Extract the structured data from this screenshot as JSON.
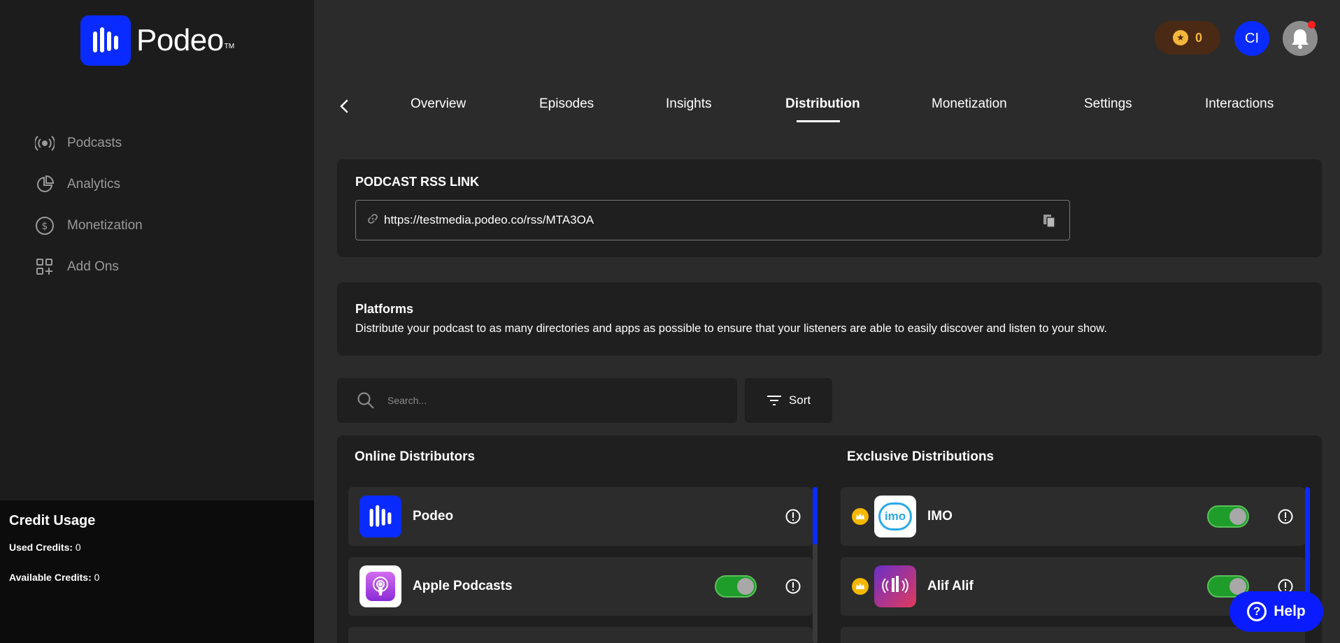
{
  "brand": {
    "name": "Podeo",
    "tm": "TM"
  },
  "sidebar": {
    "items": [
      {
        "label": "Podcasts",
        "icon": "podcast-icon"
      },
      {
        "label": "Analytics",
        "icon": "pie-chart-icon"
      },
      {
        "label": "Monetization",
        "icon": "dollar-icon"
      },
      {
        "label": "Add Ons",
        "icon": "add-ons-icon"
      }
    ],
    "credits": {
      "title": "Credit Usage",
      "used_label": "Used Credits:",
      "used_value": "0",
      "available_label": "Available Credits:",
      "available_value": "0"
    }
  },
  "header": {
    "coins": "0",
    "avatar_initials": "CI"
  },
  "tabs": [
    {
      "label": "Overview"
    },
    {
      "label": "Episodes"
    },
    {
      "label": "Insights"
    },
    {
      "label": "Distribution",
      "active": true
    },
    {
      "label": "Monetization"
    },
    {
      "label": "Settings"
    },
    {
      "label": "Interactions"
    }
  ],
  "rss": {
    "title": "PODCAST RSS LINK",
    "url": "https://testmedia.podeo.co/rss/MTA3OA"
  },
  "platforms": {
    "title": "Platforms",
    "description": "Distribute your podcast to as many directories and apps as possible to ensure that your listeners are able to easily discover and listen to your show."
  },
  "search": {
    "placeholder": "Search..."
  },
  "sort": {
    "label": "Sort"
  },
  "online": {
    "title": "Online Distributors",
    "items": [
      {
        "name": "Podeo",
        "toggle": false
      },
      {
        "name": "Apple Podcasts",
        "toggle": true
      }
    ]
  },
  "exclusive": {
    "title": "Exclusive Distributions",
    "items": [
      {
        "name": "IMO",
        "logo_text": "imo",
        "toggle": true
      },
      {
        "name": "Alif Alif",
        "toggle": true
      }
    ]
  },
  "help": {
    "label": "Help"
  },
  "colors": {
    "brand_blue": "#0a2bff",
    "toggle_green": "#1f9d2a",
    "coin_gold": "#f5b73b"
  }
}
